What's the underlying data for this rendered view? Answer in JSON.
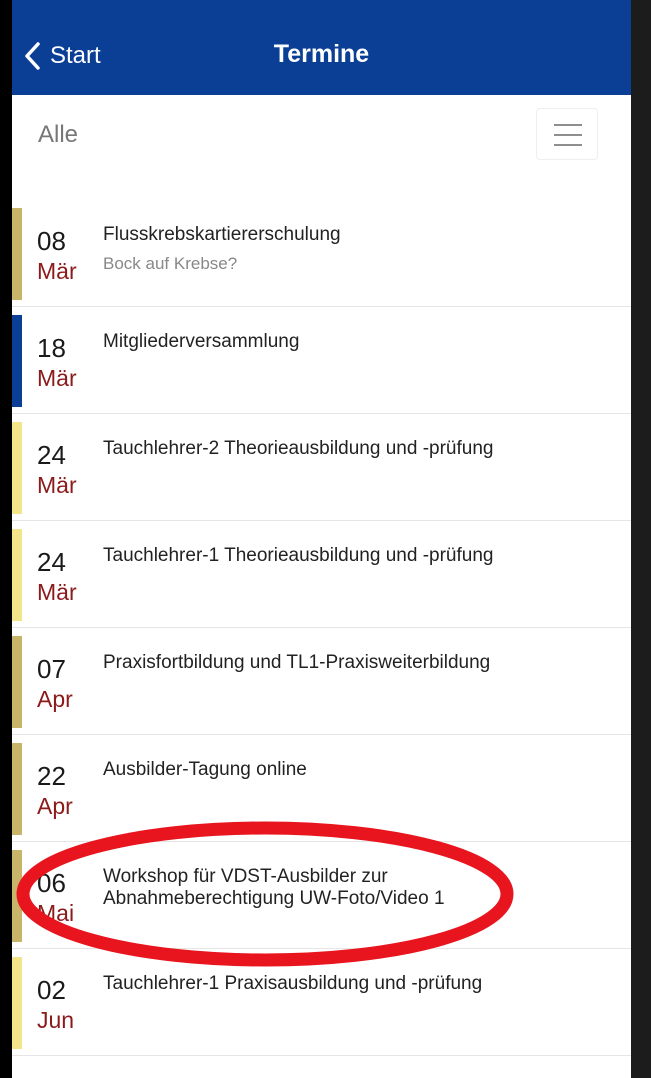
{
  "colors": {
    "header": "#0b3f96",
    "month": "#8b1a1a",
    "bar_olive": "#c9b56a",
    "bar_navy": "#0b3f96",
    "bar_yellow": "#f3e68a",
    "annotation": "#e8141e"
  },
  "header": {
    "back_label": "Start",
    "back_icon": "chevron-left-icon",
    "title": "Termine"
  },
  "filter": {
    "label": "Alle",
    "menu_icon": "hamburger-menu-icon"
  },
  "events": [
    {
      "day": "08",
      "month": "Mär",
      "title": "Flusskrebskartiererschulung",
      "subtitle": "Bock auf Krebse?",
      "bar": "#c9b56a"
    },
    {
      "day": "18",
      "month": "Mär",
      "title": "Mitgliederversammlung",
      "subtitle": "",
      "bar": "#0b3f96"
    },
    {
      "day": "24",
      "month": "Mär",
      "title": "Tauchlehrer-2 Theorieausbildung und -prüfung",
      "subtitle": "",
      "bar": "#f3e68a"
    },
    {
      "day": "24",
      "month": "Mär",
      "title": "Tauchlehrer-1 Theorieausbildung und -prüfung",
      "subtitle": "",
      "bar": "#f3e68a"
    },
    {
      "day": "07",
      "month": "Apr",
      "title": "Praxisfortbildung und TL1-Praxisweiterbildung",
      "subtitle": "",
      "bar": "#c9b56a"
    },
    {
      "day": "22",
      "month": "Apr",
      "title": "Ausbilder-Tagung online",
      "subtitle": "",
      "bar": "#c9b56a"
    },
    {
      "day": "06",
      "month": "Mai",
      "title": "Workshop für VDST-Ausbilder zur Abnahmeberechtigung UW-Foto/Video 1",
      "subtitle": "",
      "bar": "#c9b56a"
    },
    {
      "day": "02",
      "month": "Jun",
      "title": "Tauchlehrer-1 Praxisausbildung und -prüfung",
      "subtitle": "",
      "bar": "#f3e68a"
    }
  ]
}
